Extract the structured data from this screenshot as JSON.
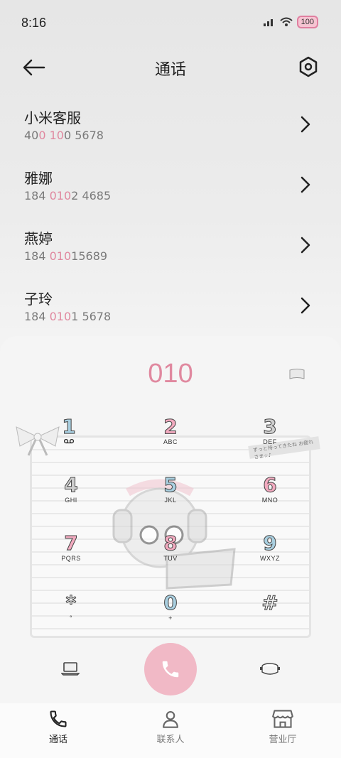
{
  "status": {
    "time": "8:16",
    "battery": "100"
  },
  "header": {
    "title": "通话"
  },
  "recents": [
    {
      "name": "小米客服",
      "number_parts": [
        "40",
        "0 10",
        "0 5678"
      ]
    },
    {
      "name": "雅娜",
      "number_parts": [
        "184 ",
        "010",
        "2 4685"
      ]
    },
    {
      "name": "燕婷",
      "number_parts": [
        "184 ",
        "010",
        "15689"
      ]
    },
    {
      "name": "子玲",
      "number_parts": [
        "184 ",
        "010",
        "1 5678"
      ]
    }
  ],
  "dialer": {
    "display": "010",
    "keys": [
      {
        "digit": "1",
        "letters": ""
      },
      {
        "digit": "2",
        "letters": "ABC"
      },
      {
        "digit": "3",
        "letters": "DEF"
      },
      {
        "digit": "4",
        "letters": "GHI"
      },
      {
        "digit": "5",
        "letters": "JKL"
      },
      {
        "digit": "6",
        "letters": "MNO"
      },
      {
        "digit": "7",
        "letters": "PQRS"
      },
      {
        "digit": "8",
        "letters": "TUV"
      },
      {
        "digit": "9",
        "letters": "WXYZ"
      },
      {
        "digit": "*",
        "letters": "°"
      },
      {
        "digit": "0",
        "letters": "+"
      },
      {
        "digit": "#",
        "letters": ""
      }
    ],
    "sticker_text": "ずっと待ってきたね お疲れさま☆♪"
  },
  "nav": [
    {
      "label": "通话",
      "icon": "phone-icon"
    },
    {
      "label": "联系人",
      "icon": "person-icon"
    },
    {
      "label": "营业厅",
      "icon": "store-icon"
    }
  ],
  "colors": {
    "accent": "#e0889f",
    "call_button": "#f1b9c6"
  }
}
